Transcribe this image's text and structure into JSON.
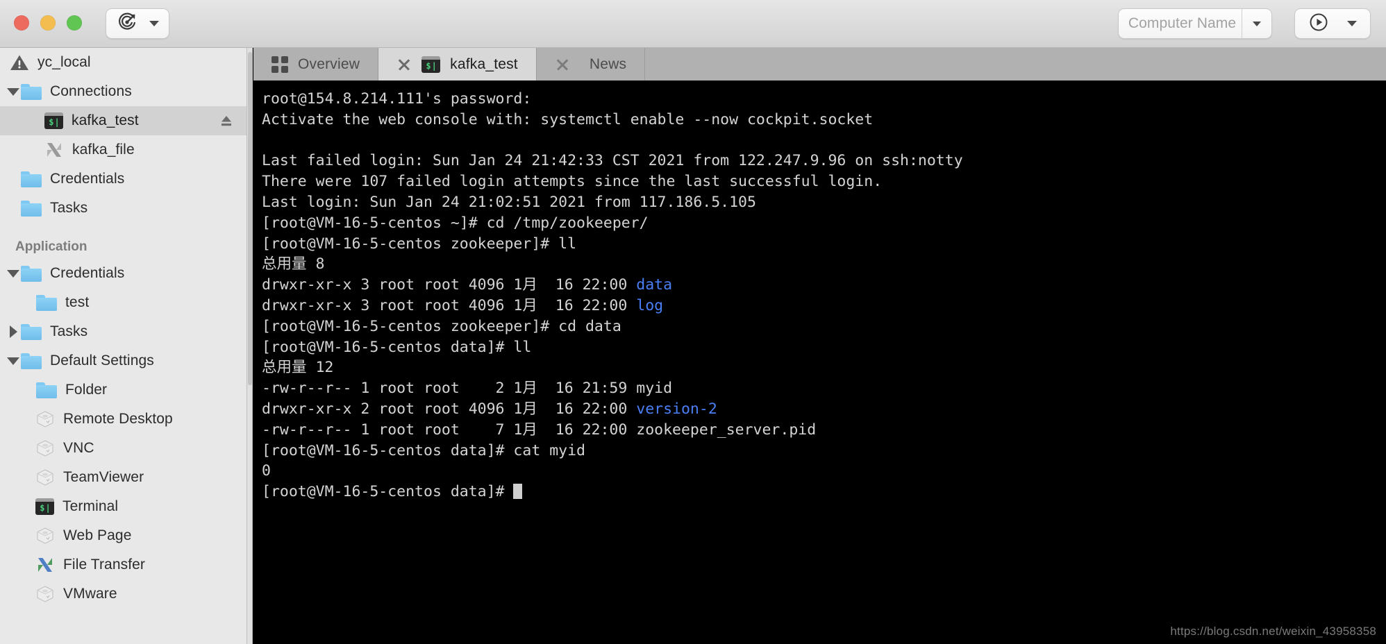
{
  "titlebar": {
    "window_controls": [
      "close",
      "minimize",
      "zoom"
    ],
    "radar_button": {
      "icon": "radar-target-icon",
      "dropdown": "chevron-down-icon"
    },
    "computer_name_field": {
      "placeholder": "Computer Name",
      "value": ""
    },
    "run_button": {
      "icon": "play-circle-icon",
      "dropdown": "chevron-down-icon"
    }
  },
  "sidebar": {
    "groups": [
      {
        "root_label": "yc_local",
        "root_icon": "warning-triangle-icon",
        "items": [
          {
            "label": "Connections",
            "icon": "folder-icon",
            "twisty": "down",
            "indent": 0,
            "selected": false
          },
          {
            "label": "kafka_test",
            "icon": "terminal-icon",
            "twisty": "none",
            "indent": 1,
            "selected": true,
            "trailing_icon": "eject-icon"
          },
          {
            "label": "kafka_file",
            "icon": "file-transfer-icon",
            "twisty": "none",
            "indent": 1,
            "selected": false
          },
          {
            "label": "Credentials",
            "icon": "folder-icon",
            "twisty": "none",
            "indent": 0,
            "selected": false
          },
          {
            "label": "Tasks",
            "icon": "folder-icon",
            "twisty": "none",
            "indent": 0,
            "selected": false
          }
        ]
      },
      {
        "title": "Application",
        "items": [
          {
            "label": "Credentials",
            "icon": "folder-icon",
            "twisty": "down",
            "indent": 0,
            "selected": false
          },
          {
            "label": "test",
            "icon": "folder-icon",
            "twisty": "none",
            "indent": 1,
            "selected": false
          },
          {
            "label": "Tasks",
            "icon": "folder-icon",
            "twisty": "right",
            "indent": 0,
            "selected": false
          },
          {
            "label": "Default Settings",
            "icon": "folder-icon",
            "twisty": "down",
            "indent": 0,
            "selected": false
          },
          {
            "label": "Folder",
            "icon": "folder-icon",
            "twisty": "none",
            "indent": 1,
            "selected": false
          },
          {
            "label": "Remote Desktop",
            "icon": "cube-icon",
            "twisty": "none",
            "indent": 1,
            "selected": false
          },
          {
            "label": "VNC",
            "icon": "cube-icon",
            "twisty": "none",
            "indent": 1,
            "selected": false
          },
          {
            "label": "TeamViewer",
            "icon": "cube-icon",
            "twisty": "none",
            "indent": 1,
            "selected": false
          },
          {
            "label": "Terminal",
            "icon": "terminal-icon",
            "twisty": "none",
            "indent": 1,
            "selected": false
          },
          {
            "label": "Web Page",
            "icon": "cube-icon",
            "twisty": "none",
            "indent": 1,
            "selected": false
          },
          {
            "label": "File Transfer",
            "icon": "file-transfer-color-icon",
            "twisty": "none",
            "indent": 1,
            "selected": false
          },
          {
            "label": "VMware",
            "icon": "cube-icon",
            "twisty": "none",
            "indent": 1,
            "selected": false
          }
        ]
      }
    ]
  },
  "tabs": [
    {
      "label": "Overview",
      "icon": "grid-icon",
      "closable": false,
      "active": false
    },
    {
      "label": "kafka_test",
      "icon": "terminal-icon",
      "closable": true,
      "active": true
    },
    {
      "label": "News",
      "icon": null,
      "closable": true,
      "active": false
    }
  ],
  "terminal": {
    "lines": [
      {
        "text": "root@154.8.214.111's password:"
      },
      {
        "text": "Activate the web console with: systemctl enable --now cockpit.socket"
      },
      {
        "text": ""
      },
      {
        "text": "Last failed login: Sun Jan 24 21:42:33 CST 2021 from 122.247.9.96 on ssh:notty"
      },
      {
        "text": "There were 107 failed login attempts since the last successful login."
      },
      {
        "text": "Last login: Sun Jan 24 21:02:51 2021 from 117.186.5.105"
      },
      {
        "text": "[root@VM-16-5-centos ~]# cd /tmp/zookeeper/"
      },
      {
        "text": "[root@VM-16-5-centos zookeeper]# ll"
      },
      {
        "text": "总用量 8"
      },
      {
        "text": "drwxr-xr-x 3 root root 4096 1月  16 22:00 ",
        "dir": "data"
      },
      {
        "text": "drwxr-xr-x 3 root root 4096 1月  16 22:00 ",
        "dir": "log"
      },
      {
        "text": "[root@VM-16-5-centos zookeeper]# cd data"
      },
      {
        "text": "[root@VM-16-5-centos data]# ll"
      },
      {
        "text": "总用量 12"
      },
      {
        "text": "-rw-r--r-- 1 root root    2 1月  16 21:59 myid"
      },
      {
        "text": "drwxr-xr-x 2 root root 4096 1月  16 22:00 ",
        "dir": "version-2"
      },
      {
        "text": "-rw-r--r-- 1 root root    7 1月  16 22:00 zookeeper_server.pid"
      },
      {
        "text": "[root@VM-16-5-centos data]# cat myid"
      },
      {
        "text": "0"
      },
      {
        "text": "[root@VM-16-5-centos data]# ",
        "cursor": true
      }
    ],
    "watermark": "https://blog.csdn.net/weixin_43958358",
    "colors": {
      "background": "#000000",
      "foreground": "#d4d4d4",
      "directory": "#4a7ff5"
    }
  }
}
